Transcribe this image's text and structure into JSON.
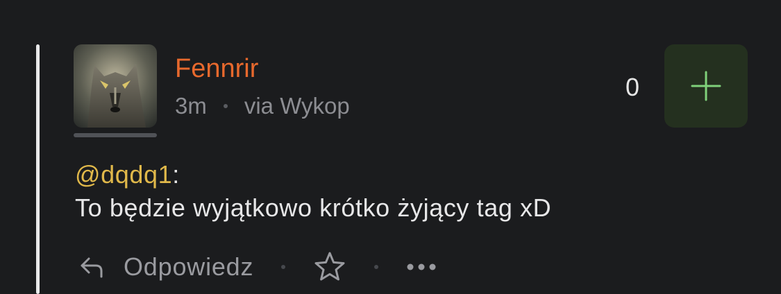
{
  "entry": {
    "author": "Fennrir",
    "time": "3m",
    "source": "via Wykop",
    "vote_count": "0",
    "mention": "@dqdq1",
    "mention_suffix": ":",
    "body": "To będzie wyjątkowo krótko żyjący tag xD"
  },
  "actions": {
    "reply_label": "Odpowiedz"
  },
  "icons": {
    "plus": "plus-icon",
    "reply": "reply-arrow-icon",
    "favorite": "star-icon",
    "more": "more-dots-icon"
  },
  "colors": {
    "background": "#1b1c1e",
    "author": "#e8692d",
    "mention": "#e0b84a",
    "plus_accent": "#7fd17a",
    "plus_bg": "#24301f"
  }
}
